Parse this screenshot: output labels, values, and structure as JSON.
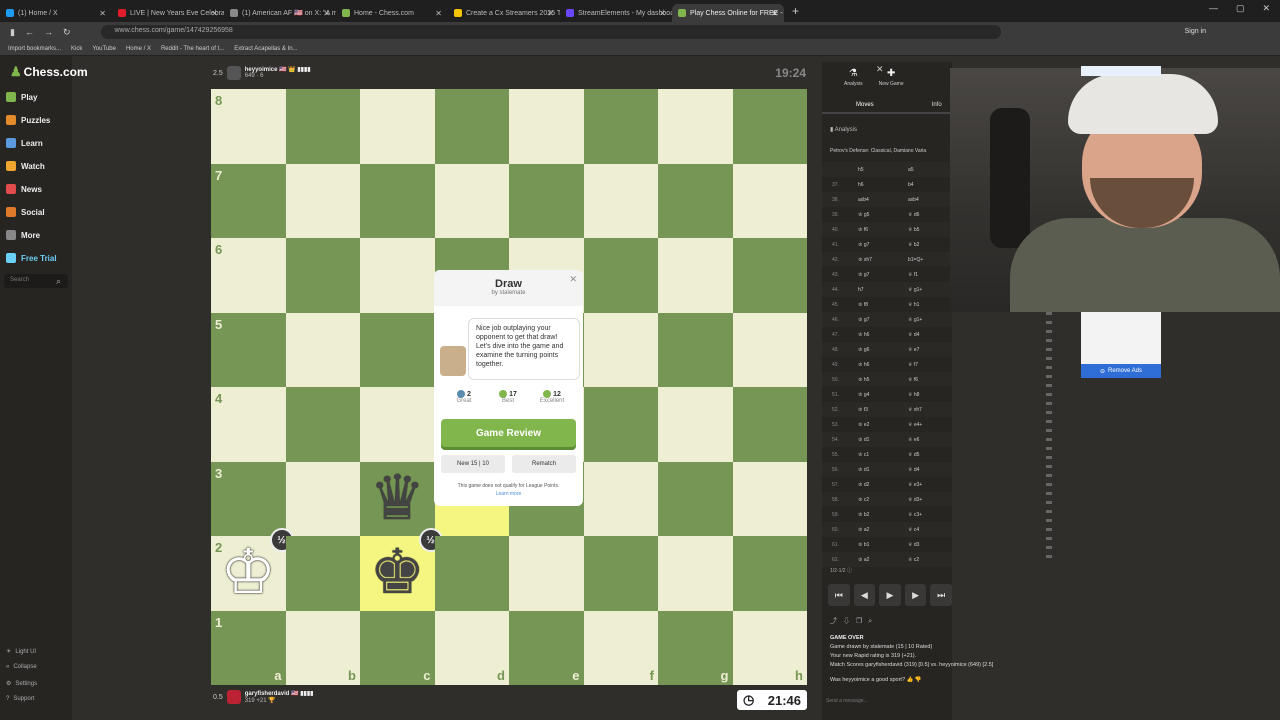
{
  "browser": {
    "tabs": [
      {
        "label": "(1) Home / X",
        "color": "#1d9bf0"
      },
      {
        "label": "LIVE | New Years Eve Celebratio",
        "color": "#e11d2c"
      },
      {
        "label": "(1) American AF 🇺🇸 on X: \"A mu",
        "color": "#888888"
      },
      {
        "label": "Home - Chess.com",
        "color": "#81b64c"
      },
      {
        "label": "Create a Cx Streamers 2025 Tie",
        "color": "#f5c400"
      },
      {
        "label": "StreamElements - My dashboar",
        "color": "#6b46ff"
      },
      {
        "label": "Play Chess Online for FREE - 2",
        "color": "#81b64c",
        "active": true
      }
    ],
    "url": "www.chess.com/game/147429256958",
    "signin": "Sign in",
    "bookmarks": [
      "Import bookmarks...",
      "Kick",
      "YouTube",
      "Home / X",
      "Reddit - The heart of t...",
      "Extract Acapellas & In..."
    ]
  },
  "sidebar": {
    "logo": "Chess.com",
    "items": [
      {
        "label": "Play",
        "color": "#81b64c"
      },
      {
        "label": "Puzzles",
        "color": "#e58b2b"
      },
      {
        "label": "Learn",
        "color": "#5d9be0"
      },
      {
        "label": "Watch",
        "color": "#f0a530"
      },
      {
        "label": "News",
        "color": "#e04c4c"
      },
      {
        "label": "Social",
        "color": "#e07a2b"
      },
      {
        "label": "More",
        "color": "#888888"
      },
      {
        "label": "Free Trial",
        "color": "#6cd0f5"
      }
    ],
    "search_placeholder": "Search",
    "footer": [
      "Light UI",
      "Collapse",
      "Settings",
      "Support"
    ]
  },
  "game": {
    "top_player": {
      "score": "2.5",
      "name": "heyyoimice 🇺🇸 👑 ▮▮▮▮",
      "rating": "649 · 6"
    },
    "top_clock": "19:24",
    "bottom_player": {
      "score": "0.5",
      "name": "garyfisherdavid 🇺🇸 ▮▮▮▮",
      "rating": "319 +21 🏆"
    },
    "bottom_clock": "21:46",
    "ranks": [
      "8",
      "7",
      "6",
      "5",
      "4",
      "3",
      "2",
      "1"
    ],
    "files": [
      "a",
      "b",
      "c",
      "d",
      "e",
      "f",
      "g",
      "h"
    ],
    "half_badge": "½"
  },
  "modal": {
    "title": "Draw",
    "subtitle": "by stalemate",
    "message": "Nice job outplaying your opponent to get that draw! Let's dive into the game and examine the turning points together.",
    "stats": [
      {
        "count": "2",
        "label": "Great",
        "color": "#5c8bb0"
      },
      {
        "count": "17",
        "label": "Best",
        "color": "#81b64c"
      },
      {
        "count": "12",
        "label": "Excellent",
        "color": "#81b64c"
      }
    ],
    "review_button": "Game Review",
    "new_button": "New 15 | 10",
    "rematch_button": "Rematch",
    "note": "This game does not qualify for League Points.",
    "learn_more": "Learn more"
  },
  "panel": {
    "tabs": [
      {
        "label": "Analysis",
        "icon": "⚗"
      },
      {
        "label": "New Game",
        "icon": "✚"
      }
    ],
    "subtabs": [
      "Moves",
      "Info"
    ],
    "analysis_label": "Analysis",
    "opening": "Petrov's Defense: Classical, Damiano Varia",
    "moves": [
      {
        "n": "",
        "w": "h5",
        "b": "a5"
      },
      {
        "n": "37.",
        "w": "h6",
        "b": "b4"
      },
      {
        "n": "38.",
        "w": "axb4",
        "b": "axb4"
      },
      {
        "n": "39.",
        "w": "♔ g5",
        "b": "♕ d6"
      },
      {
        "n": "40.",
        "w": "♔ f6",
        "b": "♕ b5"
      },
      {
        "n": "41.",
        "w": "♔ g7",
        "b": "♕ b2"
      },
      {
        "n": "42.",
        "w": "♔ xh7",
        "b": "b1=Q+"
      },
      {
        "n": "43.",
        "w": "♔ g7",
        "b": "♕ f1"
      },
      {
        "n": "44.",
        "w": "h7",
        "b": "♕ g1+"
      },
      {
        "n": "45.",
        "w": "♔ f8",
        "b": "♕ h1"
      },
      {
        "n": "46.",
        "w": "♔ g7",
        "b": "♕ g1+"
      },
      {
        "n": "47.",
        "w": "♔ h6",
        "b": "♕ d4"
      },
      {
        "n": "48.",
        "w": "♔ g6",
        "b": "♕ e7"
      },
      {
        "n": "49.",
        "w": "♔ h6",
        "b": "♕ f7"
      },
      {
        "n": "50.",
        "w": "♔ h5",
        "b": "♕ f6"
      },
      {
        "n": "51.",
        "w": "♔ g4",
        "b": "♕ h8"
      },
      {
        "n": "52.",
        "w": "♔ f3",
        "b": "♕ xh7"
      },
      {
        "n": "53.",
        "w": "♔ e2",
        "b": "♕ e4+"
      },
      {
        "n": "54.",
        "w": "♔ d1",
        "b": "♕ e6"
      },
      {
        "n": "55.",
        "w": "♔ c1",
        "b": "♕ d5"
      },
      {
        "n": "56.",
        "w": "♔ d1",
        "b": "♕ d4"
      },
      {
        "n": "57.",
        "w": "♔ d2",
        "b": "♕ e3+"
      },
      {
        "n": "58.",
        "w": "♔ c2",
        "b": "♕ d3+"
      },
      {
        "n": "59.",
        "w": "♔ b2",
        "b": "♕ c3+"
      },
      {
        "n": "60.",
        "w": "♔ a2",
        "b": "♕ c4"
      },
      {
        "n": "61.",
        "w": "♔ b1",
        "b": "♕ d3"
      },
      {
        "n": "62.",
        "w": "♔ a2",
        "b": "♕ c2"
      }
    ],
    "result": "1/2-1/2",
    "game_over": "GAME OVER",
    "summary": [
      "Game drawn by stalemate (15 | 10 Rated)",
      "Your new Rapid rating is 319 (+21).",
      "Match Scores garyfisherdavid (319) [0.5] vs. heyyoimice (649) [2.5]"
    ],
    "sport_prompt": "Was heyyoimice a good sport?",
    "chat_placeholder": "Send a message..."
  },
  "ads": {
    "remove": "Remove Ads"
  }
}
